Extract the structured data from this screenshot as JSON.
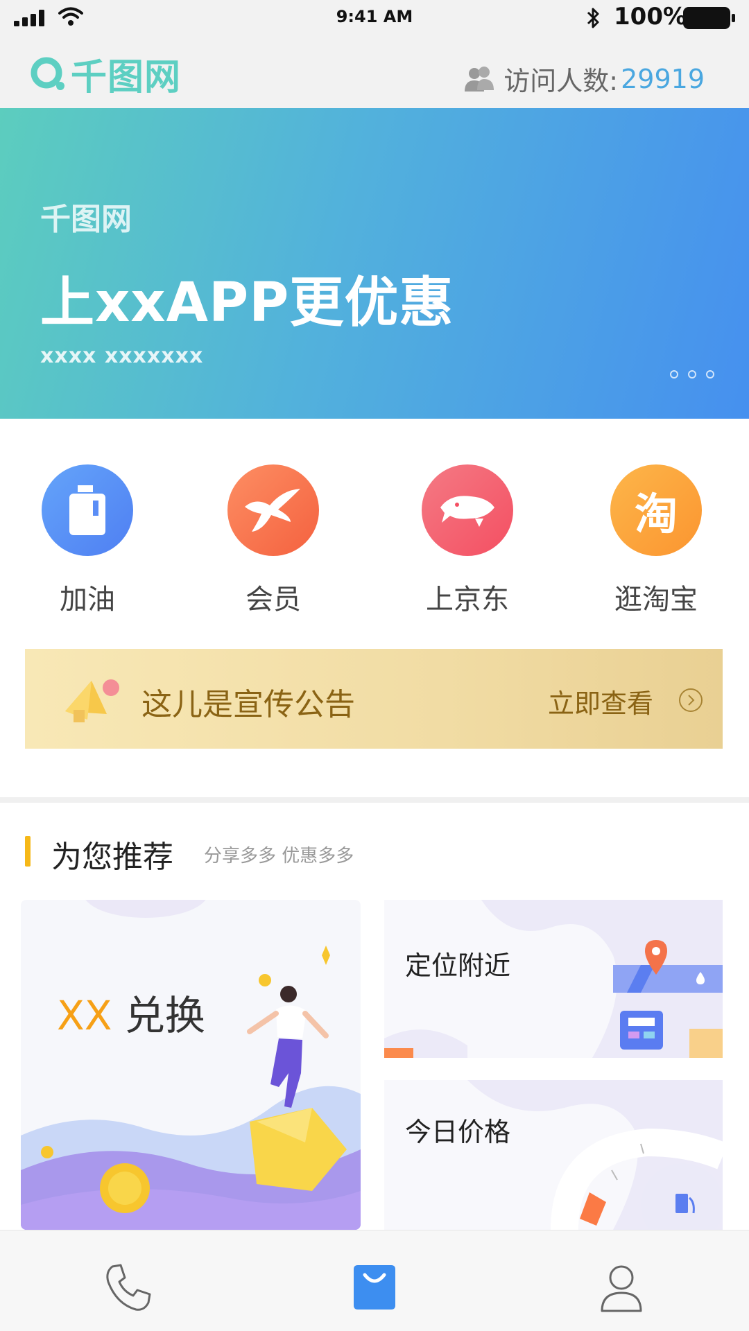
{
  "status": {
    "time": "9:41 AM",
    "battery": "100%"
  },
  "header": {
    "logo_text": "千图网",
    "visitors_label": "访问人数:",
    "visitors_count": "29919"
  },
  "banner": {
    "subtitle": "千图网",
    "title": "上xxAPP更优惠",
    "note": "xxxx  xxxxxxx",
    "page_count": 3
  },
  "quick_items": [
    {
      "label": "加油",
      "icon": "fuel-icon",
      "color": "#5b8ef6"
    },
    {
      "label": "会员",
      "icon": "plane-icon",
      "color": "#fb7a55"
    },
    {
      "label": "上京东",
      "icon": "jd-dog-icon",
      "color": "#f55a6c"
    },
    {
      "label": "逛淘宝",
      "icon": "taobao-icon",
      "color": "#fca63d",
      "glyph": "淘"
    }
  ],
  "notice": {
    "text": "这儿是宣传公告",
    "link": "立即查看"
  },
  "recommend": {
    "title": "为您推荐",
    "subtitle": "分享多多  优惠多多",
    "card_main": {
      "highlight": "XX",
      "text": "兑换"
    },
    "card_nearby": {
      "title": "定位附近"
    },
    "card_price": {
      "title": "今日价格"
    }
  },
  "tabs": [
    {
      "icon": "phone-icon",
      "active": false
    },
    {
      "icon": "shopping-bag-icon",
      "active": true,
      "color": "#3d8ef0"
    },
    {
      "icon": "user-icon",
      "active": false
    }
  ]
}
